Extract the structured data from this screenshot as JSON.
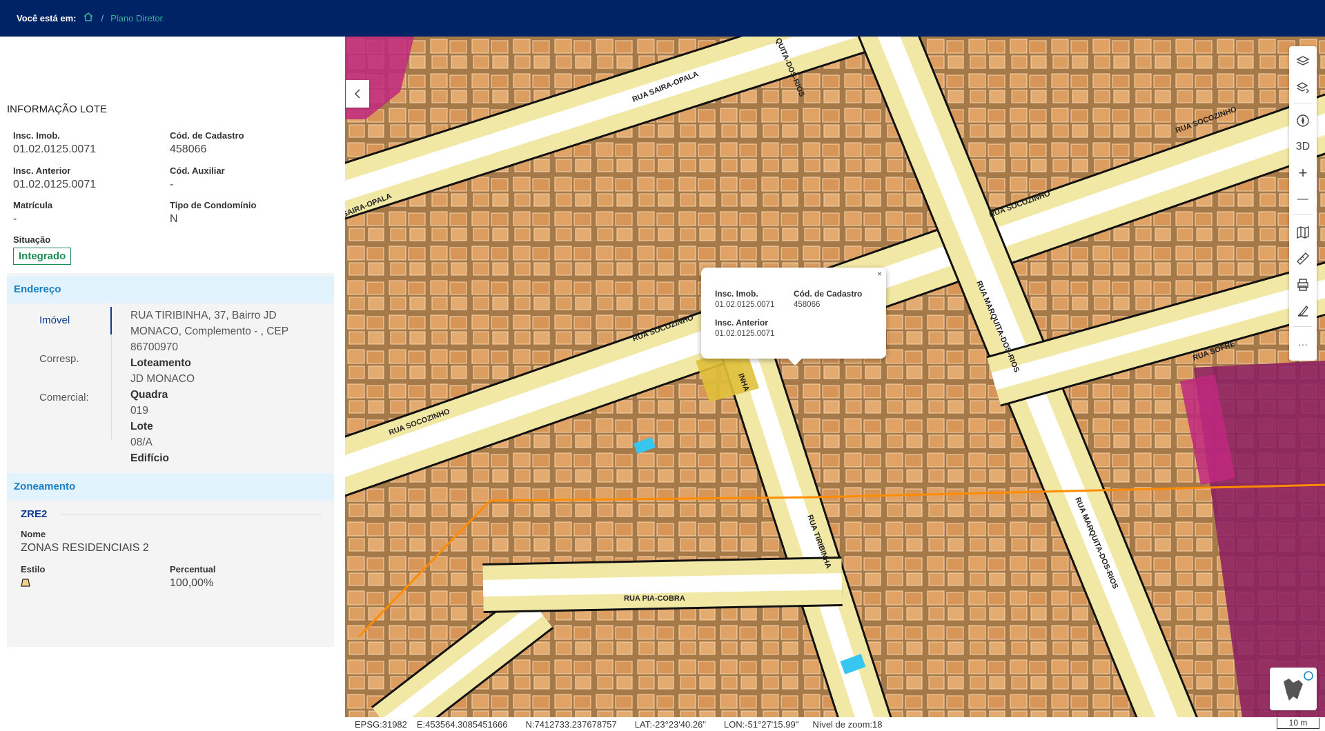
{
  "header": {
    "location_label": "Você está em:",
    "home_icon": "home-icon",
    "separator": "/",
    "breadcrumb": "Plano Diretor"
  },
  "lot_info": {
    "title": "INFORMAÇÃO LOTE",
    "insc_imob_label": "Insc. Imob.",
    "insc_imob_value": "01.02.0125.0071",
    "cod_cadastro_label": "Cód. de Cadastro",
    "cod_cadastro_value": "458066",
    "insc_anterior_label": "Insc. Anterior",
    "insc_anterior_value": "01.02.0125.0071",
    "cod_auxiliar_label": "Cód. Auxiliar",
    "cod_auxiliar_value": "-",
    "matricula_label": "Matrícula",
    "matricula_value": "-",
    "tipo_condominio_label": "Tipo de Condomínio",
    "tipo_condominio_value": "N",
    "situacao_label": "Situação",
    "situacao_value": "Integrado"
  },
  "address": {
    "title": "Endereço",
    "tabs": [
      "Imóvel",
      "Corresp.",
      "Comercial:"
    ],
    "street": "RUA TIRIBINHA, 37, Bairro JD MONACO, Complemento - , CEP 86700970",
    "loteamento_label": "Loteamento",
    "loteamento_value": "JD MONACO",
    "quadra_label": "Quadra",
    "quadra_value": "019",
    "lote_label": "Lote",
    "lote_value": "08/A",
    "edificio_label": "Edifício"
  },
  "zoning": {
    "title": "Zoneamento",
    "code": "ZRE2",
    "nome_label": "Nome",
    "nome_value": "ZONAS RESIDENCIAIS 2",
    "estilo_label": "Estilo",
    "percentual_label": "Percentual",
    "percentual_value": "100,00%",
    "style_color": "#f2d28a"
  },
  "popup": {
    "insc_imob_label": "Insc. Imob.",
    "insc_imob_value": "01.02.0125.0071",
    "cod_cadastro_label": "Cód. de Cadastro",
    "cod_cadastro_value": "458066",
    "insc_anterior_label": "Insc. Anterior",
    "insc_anterior_value": "01.02.0125.0071",
    "close": "×"
  },
  "map": {
    "streets": [
      "RUA SAIRA-OPALA",
      "SAIRA-OPALA",
      "RUA SOCOZINHO",
      "RUA SOCOZINHO",
      "RUA SOCOZINHO",
      "RUA SOCOZINHO",
      "RUA MARQUITA-DOS-RIOS",
      "RUA MARQUITA-DOS-RIOS",
      "RUA MARQUITA-DOS-RIOS",
      "RUA SOFRE",
      "RUA TIRIBINHA",
      "INHA",
      "RUA PIA-COBRA",
      "QUITA-DOS-RIOS"
    ],
    "collapse_icon": "chevron-left-icon",
    "tools": {
      "layers": "layers-icon",
      "layers_export": "layers-export-icon",
      "compass": "compass-icon",
      "three_d": "3D",
      "zoom_in": "+",
      "zoom_out": "—",
      "basemap": "map-icon",
      "measure": "ruler-icon",
      "print": "printer-icon",
      "draw": "draw-icon",
      "more": "···"
    },
    "colors": {
      "road": "#f2e8a6",
      "road_border": "#111111",
      "zone_border": "#ff8c00",
      "lot_magenta": "#c0287f",
      "highlight": "#e0c03a",
      "pool": "#37c6f0"
    }
  },
  "status": {
    "epsg": "EPSG:31982",
    "east": "E:453564.3085451666",
    "north": "N:7412733.237678757",
    "lat": "LAT:-23°23'40.26\"",
    "lon": "LON:-51°27'15.99\"",
    "zoom": "Nível de zoom:18",
    "scale": "10 m"
  }
}
